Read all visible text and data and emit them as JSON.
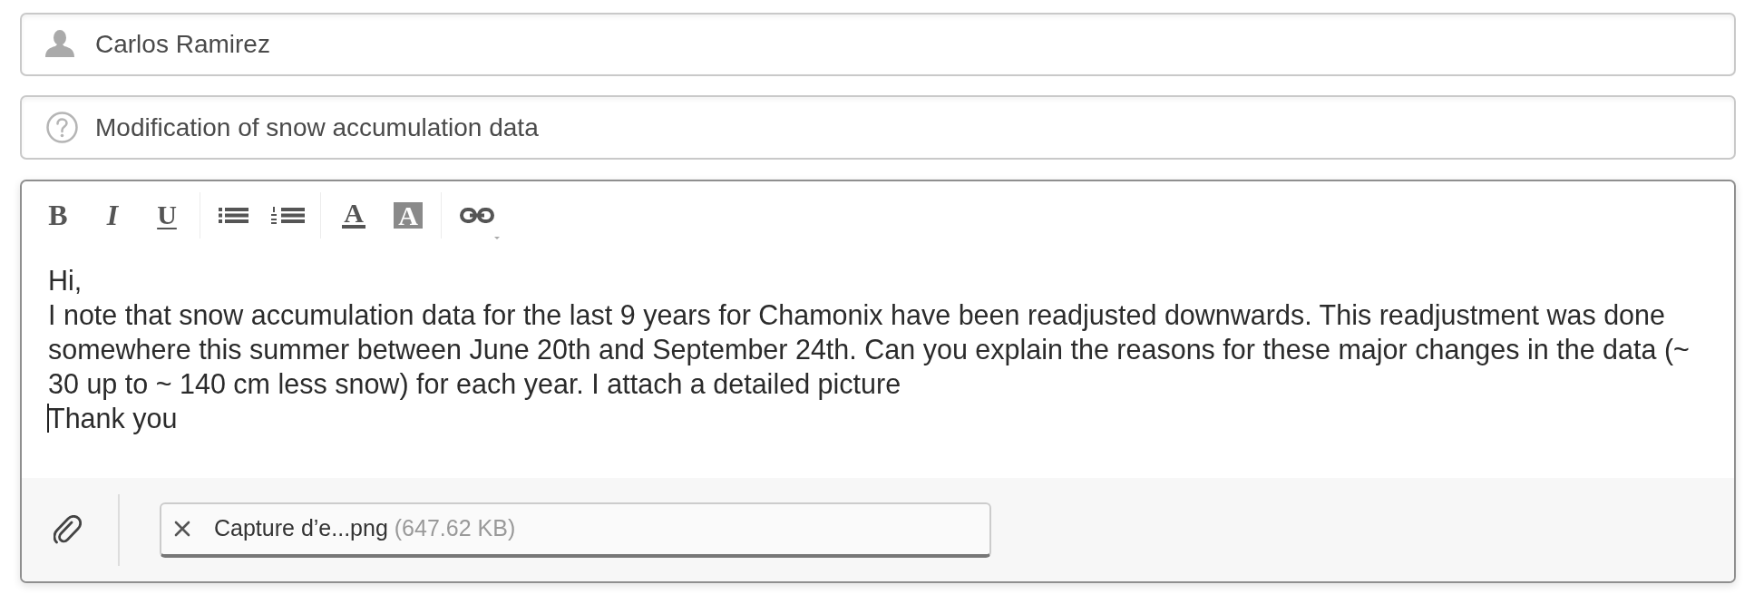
{
  "recipient": {
    "value": "Carlos Ramirez"
  },
  "subject": {
    "value": "Modification of snow accumulation data"
  },
  "toolbar": [
    [
      {
        "kind": "bold",
        "label": "B"
      },
      {
        "kind": "italic",
        "label": "I"
      },
      {
        "kind": "underline",
        "label": "U"
      }
    ],
    [
      {
        "kind": "bullet_list"
      },
      {
        "kind": "numbered_list"
      }
    ],
    [
      {
        "kind": "text_color",
        "label": "A"
      },
      {
        "kind": "highlight",
        "label": "A"
      }
    ],
    [
      {
        "kind": "link"
      }
    ]
  ],
  "body": [
    {
      "text": "Hi,",
      "caret": false
    },
    {
      "text": "I note that snow accumulation data for the last 9 years for Chamonix have been readjusted downwards. This readjustment was done somewhere this summer between June 20th and September 24th. Can you explain the reasons for these major changes in the data (~ 30 up to ~ 140 cm less snow) for each year. I attach a detailed picture",
      "caret": false
    },
    {
      "text": "Thank you",
      "caret": true
    }
  ],
  "attachments": [
    {
      "name": "Capture d’e...png",
      "size": "(647.62 KB)"
    }
  ]
}
